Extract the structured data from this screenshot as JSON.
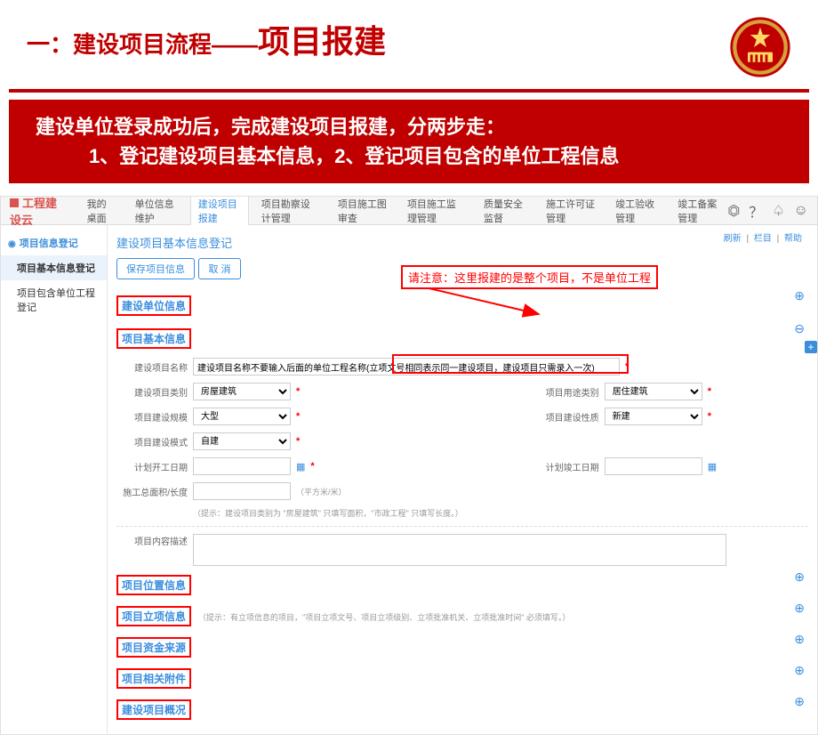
{
  "slide": {
    "title_prefix": "一：建设项目流程——",
    "title_main": "项目报建",
    "banner_line1": "建设单位登录成功后，完成建设项目报建，分两步走：",
    "banner_line2": "1、登记建设项目基本信息，2、登记项目包含的单位工程信息"
  },
  "app": {
    "brand": "工程建设云",
    "tabs": [
      "我的桌面",
      "单位信息维护",
      "建设项目报建",
      "项目勘察设计管理",
      "项目施工图审查",
      "项目施工监理管理",
      "质量安全监督",
      "施工许可证管理",
      "竣工验收管理",
      "竣工备案管理"
    ],
    "tab_active_index": 2,
    "top_links": {
      "refresh": "刷新",
      "menu": "栏目",
      "help": "帮助"
    },
    "sidebar": {
      "head": "项目信息登记",
      "items": [
        "项目基本信息登记",
        "项目包含单位工程登记"
      ],
      "active_index": 0
    },
    "page": {
      "title": "建设项目基本信息登记",
      "btn_save": "保存项目信息",
      "btn_cancel": "取  消",
      "callout": "请注意：这里报建的是整个项目，不是单位工程"
    },
    "sections": {
      "s1": "建设单位信息",
      "s2": "项目基本信息",
      "s3": "项目位置信息",
      "s4": "项目立项信息",
      "s4_hint": "（提示：有立项信息的项目，\"项目立项文号、项目立项级别、立项批准机关、立项批准时间\" 必须填写。）",
      "s5": "项目资金来源",
      "s6": "项目相关附件",
      "s7": "建设项目概况"
    },
    "form": {
      "name_label": "建设项目名称",
      "name_value": "建设项目名称不要输入后面的单位工程名称(立项文号相同表示同一建设项目，建设项目只需录入一次)",
      "class_label": "建设项目类别",
      "class_value": "房屋建筑",
      "use_label": "项目用途类别",
      "use_value": "居住建筑",
      "scale_label": "项目建设规模",
      "scale_value": "大型",
      "nature_label": "项目建设性质",
      "nature_value": "新建",
      "mode_label": "项目建设模式",
      "mode_value": "自建",
      "start_label": "计划开工日期",
      "start_value": "",
      "end_label": "计划竣工日期",
      "end_value": "",
      "area_label": "施工总面积/长度",
      "area_value": "",
      "area_unit": "（平方米/米）",
      "area_hint": "（提示：建设项目类别为 \"房屋建筑\" 只填写面积，\"市政工程\" 只填写长度。）",
      "desc_label": "项目内容描述",
      "desc_value": ""
    }
  }
}
